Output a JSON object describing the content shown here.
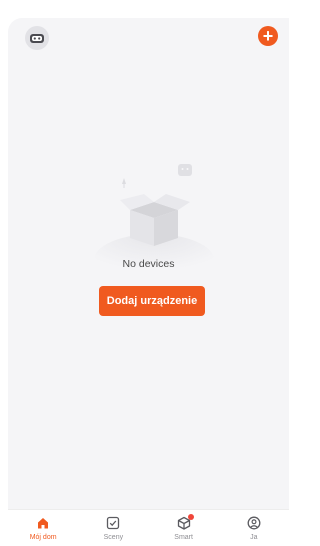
{
  "header": {
    "avatar_icon": "robot-avatar-icon",
    "add_icon": "plus-icon",
    "add_symbol": "+"
  },
  "empty_state": {
    "illustration_icon": "empty-box-icon",
    "message": "No devices",
    "button_label": "Dodaj urządzenie"
  },
  "tabbar": {
    "items": [
      {
        "label": "Mój dom",
        "icon": "home-icon",
        "active": true
      },
      {
        "label": "Sceny",
        "icon": "checkbox-icon",
        "active": false
      },
      {
        "label": "Smart",
        "icon": "cube-icon",
        "active": false,
        "badge": true
      },
      {
        "label": "Ja",
        "icon": "profile-icon",
        "active": false
      }
    ]
  },
  "colors": {
    "accent": "#f05a1f",
    "background": "#f5f5f7",
    "badge": "#f0463a"
  }
}
